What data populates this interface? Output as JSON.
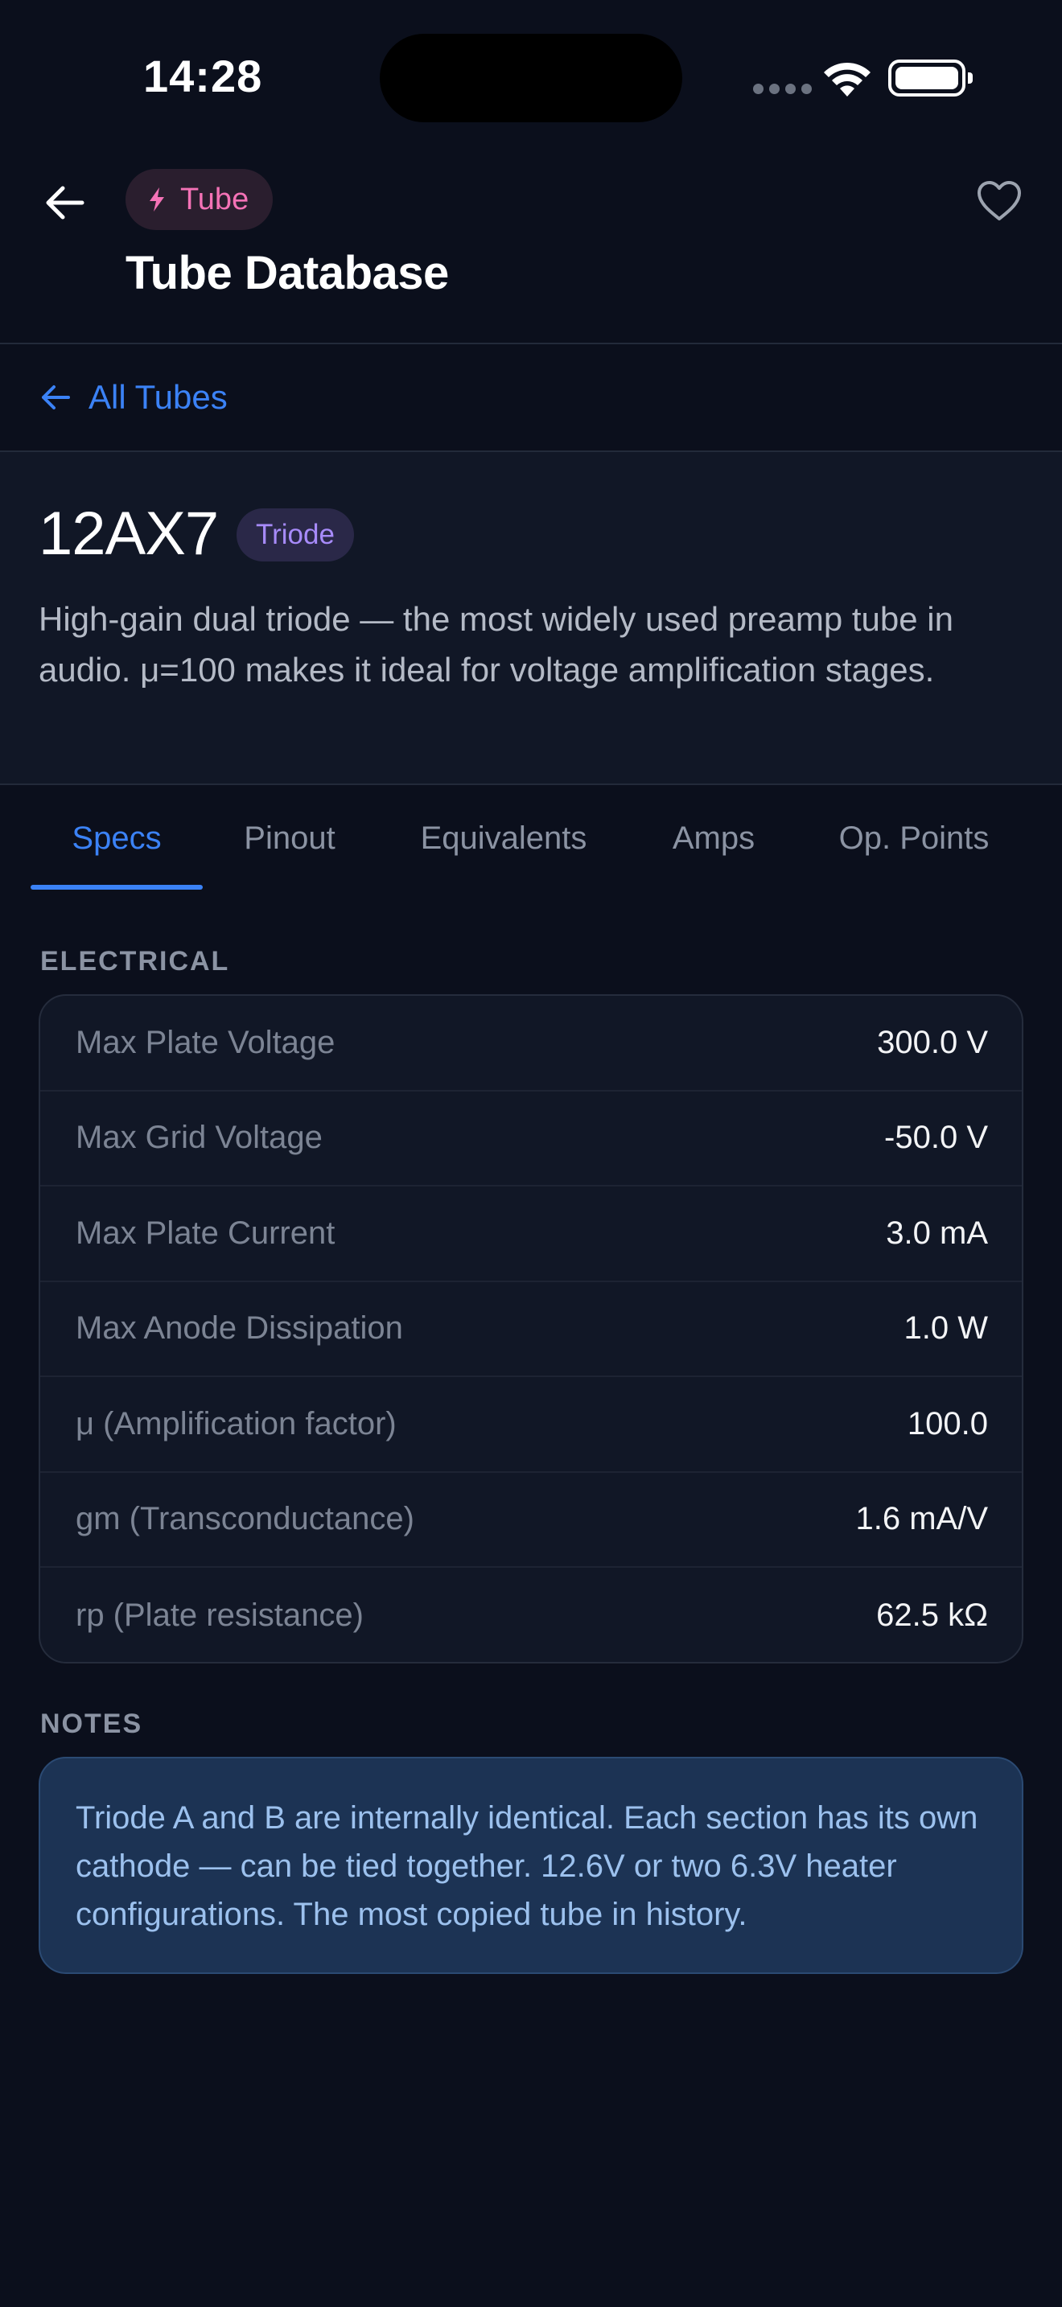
{
  "status_bar": {
    "time": "14:28"
  },
  "app_bar": {
    "chip_label": "Tube",
    "chip_color": "#f472b6",
    "title": "Tube Database"
  },
  "nav": {
    "back_link_label": "All Tubes"
  },
  "tube": {
    "name": "12AX7",
    "type": "Triode",
    "description": "High-gain dual triode — the most widely used preamp tube in audio. μ=100 makes it ideal for voltage amplification stages."
  },
  "tabs": [
    {
      "label": "Specs",
      "active": true
    },
    {
      "label": "Pinout",
      "active": false
    },
    {
      "label": "Equivalents",
      "active": false
    },
    {
      "label": "Amps",
      "active": false
    },
    {
      "label": "Op. Points",
      "active": false
    }
  ],
  "electrical": {
    "section_label": "ELECTRICAL",
    "rows": [
      {
        "label": "Max Plate Voltage",
        "value": "300.0 V"
      },
      {
        "label": "Max Grid Voltage",
        "value": "-50.0 V"
      },
      {
        "label": "Max Plate Current",
        "value": "3.0 mA"
      },
      {
        "label": "Max Anode Dissipation",
        "value": "1.0 W"
      },
      {
        "label": "μ (Amplification factor)",
        "value": "100.0"
      },
      {
        "label": "gm (Transconductance)",
        "value": "1.6 mA/V"
      },
      {
        "label": "rp (Plate resistance)",
        "value": "62.5 kΩ"
      }
    ]
  },
  "notes": {
    "section_label": "NOTES",
    "text": "Triode A and B are internally identical. Each section has its own cathode — can be tied together. 12.6V or two 6.3V heater configurations. The most copied tube in history."
  },
  "colors": {
    "accent": "#3b82f6",
    "background": "#0b0f1c",
    "badge_purple": "#a78bfa"
  }
}
